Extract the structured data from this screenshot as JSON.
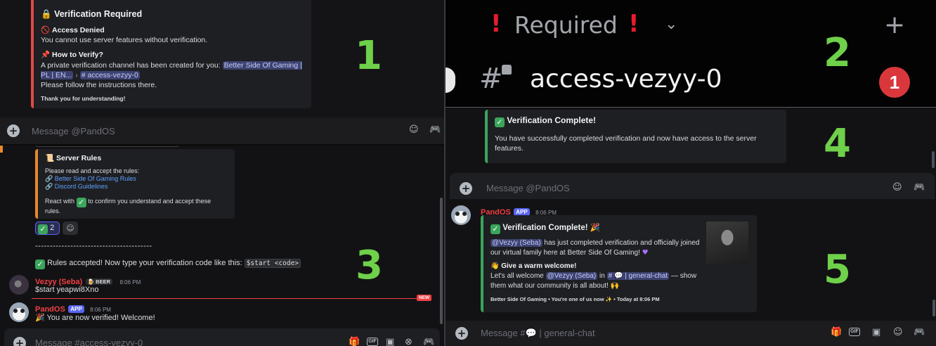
{
  "panel_numbers": [
    "1",
    "2",
    "3",
    "4",
    "5"
  ],
  "p1": {
    "title": "Verification Required",
    "denied_title": "Access Denied",
    "denied_text": "You cannot use server features without verification.",
    "how_title": "How to Verify?",
    "how_text": "A private verification channel has been created for you:",
    "server_chip": "Better Side Of Gaming | PL | EN...",
    "chip_sep": "›",
    "channel_chip": "# access-vezyy-0",
    "follow_text": "Please follow the instructions there.",
    "thanks": "Thank you for understanding!",
    "input_placeholder": "Message @PandOS"
  },
  "p2": {
    "category": "Required",
    "channel": "access-vezyy-0",
    "badge_count": "1"
  },
  "p3": {
    "rules_title": "Server Rules",
    "rules_intro": "Please read and accept the rules:",
    "rule_link_1": "Better Side Of Gaming Rules",
    "rule_link_2": "Discord Guidelines",
    "react_pre": "React with",
    "react_post": "to confirm you understand and accept these rules.",
    "reaction_count": "2",
    "dashes": "----------------------------------------",
    "accepted_text": "Rules accepted! Now type your verification code like this:",
    "code_example": "$start <code>",
    "user_name": "Vezyy (Seba)",
    "user_tag": "BEER",
    "user_time": "8:06 PM",
    "user_message": "$start yeapwi8Xno",
    "new_badge": "NEW",
    "bot_name": "PandOS",
    "bot_tag": "APP",
    "bot_time": "8:06 PM",
    "bot_message": "You are now verified! Welcome!",
    "input_placeholder": "Message #access-vezyy-0"
  },
  "p4": {
    "title": "Verification Complete!",
    "text": "You have successfully completed verification and now have access to the server features.",
    "input_placeholder": "Message @PandOS"
  },
  "p5": {
    "bot_name": "PandOS",
    "bot_tag": "APP",
    "bot_time": "8:06 PM",
    "title": "Verification Complete!",
    "mention": "@Vezyy (Seba)",
    "line1_rest": "has just completed verification and officially joined our virtual family here at Better Side Of Gaming!",
    "welcome_title": "Give a warm welcome!",
    "welcome_pre": "Let's all welcome",
    "welcome_in": "in",
    "channel_chip": "# 💬 | general-chat",
    "welcome_post": "— show them what our community is all about!",
    "footer": "Better Side Of Gaming • You're one of us now ✨ • Today at 8:06 PM",
    "input_placeholder": "Message #💬 | general-chat"
  },
  "colors": {
    "accent_green": "#6fd04a",
    "embed_red": "#e04848",
    "embed_orange": "#e8892b",
    "embed_green": "#3ba55c",
    "username_red": "#f23f43",
    "app_tag": "#5865f2"
  }
}
